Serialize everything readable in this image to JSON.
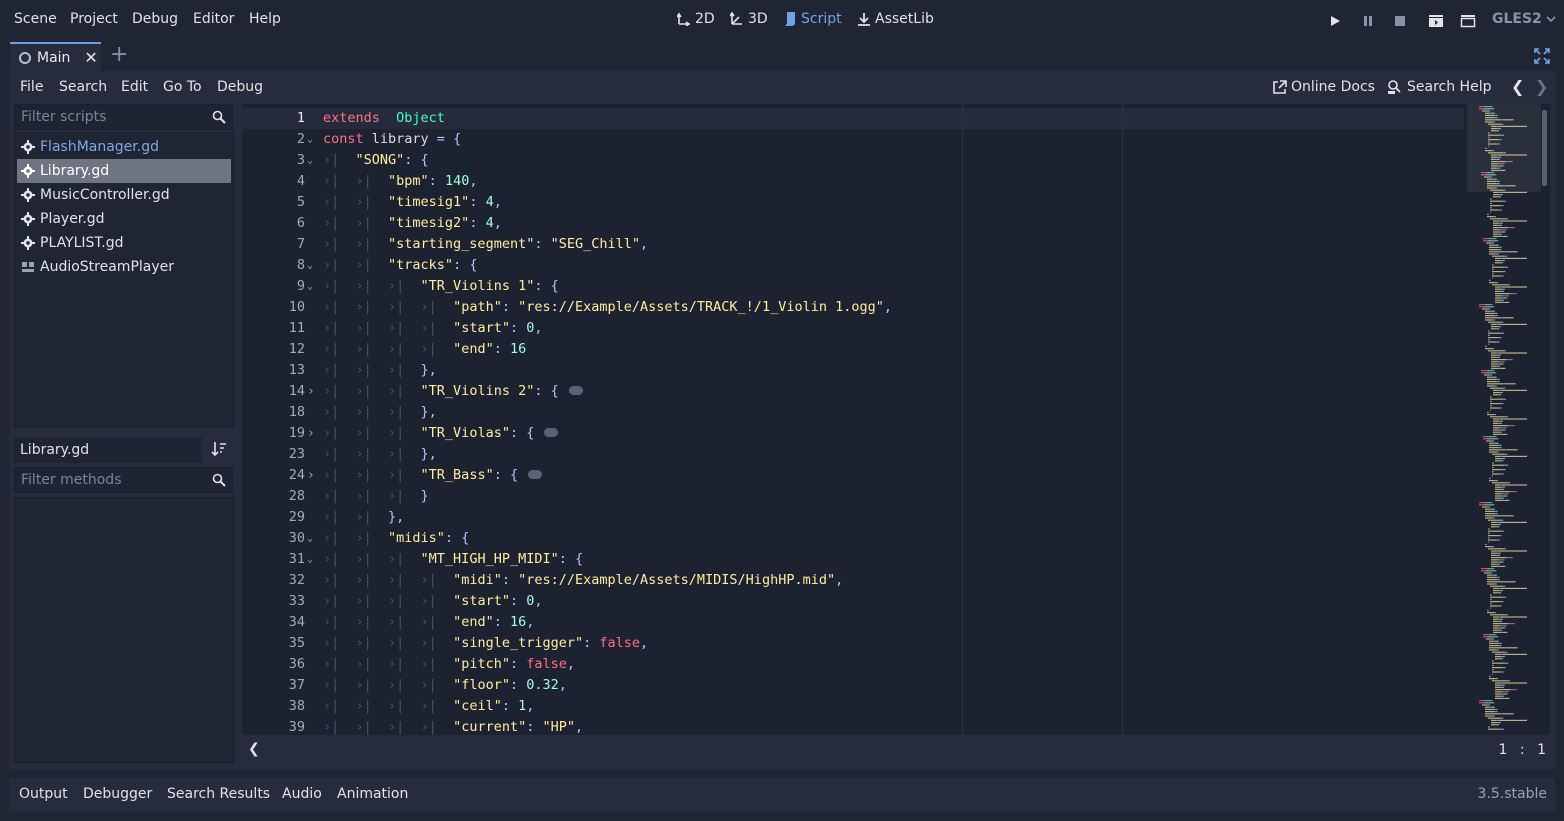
{
  "menubar": {
    "items": [
      "Scene",
      "Project",
      "Debug",
      "Editor",
      "Help"
    ]
  },
  "workspaces": {
    "items": [
      "2D",
      "3D",
      "Script",
      "AssetLib"
    ],
    "active": "Script"
  },
  "renderer": "GLES2",
  "scene_tabs": {
    "current": "Main"
  },
  "script_menu": {
    "items": [
      "File",
      "Search",
      "Edit",
      "Go To",
      "Debug"
    ],
    "online_docs": "Online Docs",
    "search_help": "Search Help"
  },
  "scripts": {
    "filter_placeholder": "Filter scripts",
    "items": [
      {
        "label": "FlashManager.gd",
        "icon": "gear-icon"
      },
      {
        "label": "Library.gd",
        "icon": "gear-icon"
      },
      {
        "label": "MusicController.gd",
        "icon": "gear-icon"
      },
      {
        "label": "Player.gd",
        "icon": "gear-icon"
      },
      {
        "label": "PLAYLIST.gd",
        "icon": "gear-icon"
      },
      {
        "label": "AudioStreamPlayer",
        "icon": "doc-icon"
      }
    ],
    "selected": "Library.gd"
  },
  "methods": {
    "current_script": "Library.gd",
    "filter_placeholder": "Filter methods"
  },
  "editor": {
    "caret": {
      "line": "1",
      "sep": ":",
      "col": "1"
    },
    "lines": [
      {
        "n": "1",
        "fold": "",
        "indent": 0,
        "tokens": [
          [
            "kw",
            "extends"
          ],
          [
            "",
            "  "
          ],
          [
            "ty",
            "Object"
          ]
        ]
      },
      {
        "n": "2",
        "fold": "v",
        "indent": 0,
        "tokens": [
          [
            "kw",
            "const"
          ],
          [
            "",
            " library "
          ],
          [
            "pu",
            "="
          ],
          [
            "",
            " "
          ],
          [
            "pu",
            "{"
          ]
        ]
      },
      {
        "n": "3",
        "fold": "v",
        "indent": 1,
        "tokens": [
          [
            "st",
            "\"SONG\""
          ],
          [
            "pu",
            ": {"
          ]
        ]
      },
      {
        "n": "4",
        "fold": "",
        "indent": 2,
        "tokens": [
          [
            "st",
            "\"bpm\""
          ],
          [
            "pu",
            ": "
          ],
          [
            "nu",
            "140"
          ],
          [
            "pu",
            ","
          ]
        ]
      },
      {
        "n": "5",
        "fold": "",
        "indent": 2,
        "tokens": [
          [
            "st",
            "\"timesig1\""
          ],
          [
            "pu",
            ": "
          ],
          [
            "nu",
            "4"
          ],
          [
            "pu",
            ","
          ]
        ]
      },
      {
        "n": "6",
        "fold": "",
        "indent": 2,
        "tokens": [
          [
            "st",
            "\"timesig2\""
          ],
          [
            "pu",
            ": "
          ],
          [
            "nu",
            "4"
          ],
          [
            "pu",
            ","
          ]
        ]
      },
      {
        "n": "7",
        "fold": "",
        "indent": 2,
        "tokens": [
          [
            "st",
            "\"starting_segment\""
          ],
          [
            "pu",
            ": "
          ],
          [
            "st",
            "\"SEG_Chill\""
          ],
          [
            "pu",
            ","
          ]
        ]
      },
      {
        "n": "8",
        "fold": "v",
        "indent": 2,
        "tokens": [
          [
            "st",
            "\"tracks\""
          ],
          [
            "pu",
            ": {"
          ]
        ]
      },
      {
        "n": "9",
        "fold": "v",
        "indent": 3,
        "tokens": [
          [
            "st",
            "\"TR_Violins 1\""
          ],
          [
            "pu",
            ": {"
          ]
        ]
      },
      {
        "n": "10",
        "fold": "",
        "indent": 4,
        "tokens": [
          [
            "st",
            "\"path\""
          ],
          [
            "pu",
            ": "
          ],
          [
            "st",
            "\"res://Example/Assets/TRACK_!/1_Violin 1.ogg\""
          ],
          [
            "pu",
            ","
          ]
        ]
      },
      {
        "n": "11",
        "fold": "",
        "indent": 4,
        "tokens": [
          [
            "st",
            "\"start\""
          ],
          [
            "pu",
            ": "
          ],
          [
            "nu",
            "0"
          ],
          [
            "pu",
            ","
          ]
        ]
      },
      {
        "n": "12",
        "fold": "",
        "indent": 4,
        "tokens": [
          [
            "st",
            "\"end\""
          ],
          [
            "pu",
            ": "
          ],
          [
            "nu",
            "16"
          ]
        ]
      },
      {
        "n": "13",
        "fold": "",
        "indent": 3,
        "tokens": [
          [
            "pu",
            "},"
          ]
        ]
      },
      {
        "n": "14",
        "fold": ">",
        "indent": 3,
        "tokens": [
          [
            "st",
            "\"TR_Violins 2\""
          ],
          [
            "pu",
            ": { "
          ],
          [
            "ellipsis",
            ""
          ]
        ]
      },
      {
        "n": "18",
        "fold": "",
        "indent": 3,
        "tokens": [
          [
            "pu",
            "},"
          ]
        ]
      },
      {
        "n": "19",
        "fold": ">",
        "indent": 3,
        "tokens": [
          [
            "st",
            "\"TR_Violas\""
          ],
          [
            "pu",
            ": { "
          ],
          [
            "ellipsis",
            ""
          ]
        ]
      },
      {
        "n": "23",
        "fold": "",
        "indent": 3,
        "tokens": [
          [
            "pu",
            "},"
          ]
        ]
      },
      {
        "n": "24",
        "fold": ">",
        "indent": 3,
        "tokens": [
          [
            "st",
            "\"TR_Bass\""
          ],
          [
            "pu",
            ": { "
          ],
          [
            "ellipsis",
            ""
          ]
        ]
      },
      {
        "n": "28",
        "fold": "",
        "indent": 3,
        "tokens": [
          [
            "pu",
            "}"
          ]
        ]
      },
      {
        "n": "29",
        "fold": "",
        "indent": 2,
        "tokens": [
          [
            "pu",
            "},"
          ]
        ]
      },
      {
        "n": "30",
        "fold": "v",
        "indent": 2,
        "tokens": [
          [
            "st",
            "\"midis\""
          ],
          [
            "pu",
            ": {"
          ]
        ]
      },
      {
        "n": "31",
        "fold": "v",
        "indent": 3,
        "tokens": [
          [
            "st",
            "\"MT_HIGH_HP_MIDI\""
          ],
          [
            "pu",
            ": {"
          ]
        ]
      },
      {
        "n": "32",
        "fold": "",
        "indent": 4,
        "tokens": [
          [
            "st",
            "\"midi\""
          ],
          [
            "pu",
            ": "
          ],
          [
            "st",
            "\"res://Example/Assets/MIDIS/HighHP.mid\""
          ],
          [
            "pu",
            ","
          ]
        ]
      },
      {
        "n": "33",
        "fold": "",
        "indent": 4,
        "tokens": [
          [
            "st",
            "\"start\""
          ],
          [
            "pu",
            ": "
          ],
          [
            "nu",
            "0"
          ],
          [
            "pu",
            ","
          ]
        ]
      },
      {
        "n": "34",
        "fold": "",
        "indent": 4,
        "tokens": [
          [
            "st",
            "\"end\""
          ],
          [
            "pu",
            ": "
          ],
          [
            "nu",
            "16"
          ],
          [
            "pu",
            ","
          ]
        ]
      },
      {
        "n": "35",
        "fold": "",
        "indent": 4,
        "tokens": [
          [
            "st",
            "\"single_trigger\""
          ],
          [
            "pu",
            ": "
          ],
          [
            "fa",
            "false"
          ],
          [
            "pu",
            ","
          ]
        ]
      },
      {
        "n": "36",
        "fold": "",
        "indent": 4,
        "tokens": [
          [
            "st",
            "\"pitch\""
          ],
          [
            "pu",
            ": "
          ],
          [
            "fa",
            "false"
          ],
          [
            "pu",
            ","
          ]
        ]
      },
      {
        "n": "37",
        "fold": "",
        "indent": 4,
        "tokens": [
          [
            "st",
            "\"floor\""
          ],
          [
            "pu",
            ": "
          ],
          [
            "nu",
            "0.32"
          ],
          [
            "pu",
            ","
          ]
        ]
      },
      {
        "n": "38",
        "fold": "",
        "indent": 4,
        "tokens": [
          [
            "st",
            "\"ceil\""
          ],
          [
            "pu",
            ": "
          ],
          [
            "nu",
            "1"
          ],
          [
            "pu",
            ","
          ]
        ]
      },
      {
        "n": "39",
        "fold": "",
        "indent": 4,
        "tokens": [
          [
            "st",
            "\"current\""
          ],
          [
            "pu",
            ": "
          ],
          [
            "st",
            "\"HP\""
          ],
          [
            "pu",
            ","
          ]
        ]
      }
    ]
  },
  "bottom_tabs": [
    "Output",
    "Debugger",
    "Search Results",
    "Audio",
    "Animation"
  ],
  "version": "3.5.stable",
  "colors": {
    "accent": "#70a4e8",
    "background": "#1f2533",
    "panel": "#262c3b",
    "editor": "#1d2230"
  }
}
